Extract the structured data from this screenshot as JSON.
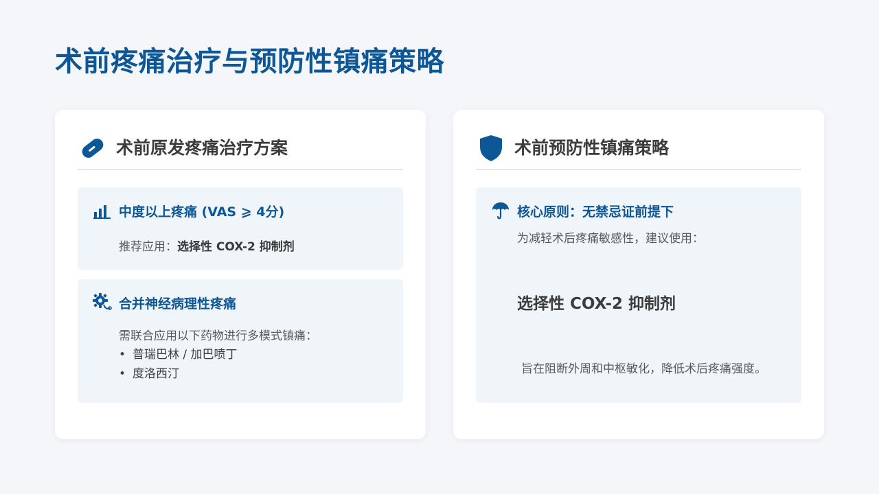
{
  "page": {
    "title": "术前疼痛治疗与预防性镇痛策略"
  },
  "left_card": {
    "icon": "pill-icon",
    "title": "术前原发疼痛治疗方案",
    "box1": {
      "icon": "bar-chart-icon",
      "title": "中度以上疼痛 (VAS ⩾ 4分)",
      "text_prefix": "推荐应用：",
      "text_bold": "选择性 COX-2 抑制剂"
    },
    "box2": {
      "icon": "nerve-gear-icon",
      "title": "合并神经病理性疼痛",
      "text": "需联合应用以下药物进行多模式镇痛：",
      "items": [
        "普瑞巴林 / 加巴喷丁",
        "度洛西汀"
      ]
    }
  },
  "right_card": {
    "icon": "shield-icon",
    "title": "术前预防性镇痛策略",
    "box": {
      "icon": "umbrella-icon",
      "title": "核心原则：无禁忌证前提下",
      "subtitle": "为减轻术后疼痛敏感性，建议使用：",
      "highlight": "选择性 COX-2 抑制剂",
      "footnote": "旨在阻断外周和中枢敏化，降低术后疼痛强度。"
    }
  },
  "colors": {
    "accent": "#0e5796",
    "background": "#f4f6fa",
    "box_bg": "#eff5f9"
  }
}
